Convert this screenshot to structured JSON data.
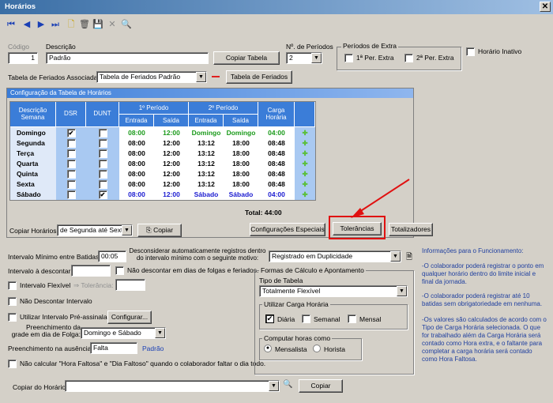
{
  "window": {
    "title": "Horários",
    "close": "✕"
  },
  "toolbar": {
    "first": "⏮",
    "prev": "◀",
    "next": "▶",
    "last": "⏭",
    "new": "🗋",
    "delete": "🗑",
    "save": "💾",
    "cancel": "✕",
    "search": "🔍"
  },
  "form": {
    "codigo_label": "Código",
    "codigo_value": "1",
    "descricao_label": "Descrição",
    "descricao_value": "Padrão",
    "copiar_tabela": "Copiar Tabela",
    "num_periodos_label": "Nº. de Períodos",
    "num_periodos_value": "2",
    "periodos_extra_label": "Períodos de Extra",
    "per_extra1": "1ª Per. Extra",
    "per_extra2": "2ª Per. Extra",
    "horario_inativo": "Horário Inativo",
    "feriados_label": "Tabela de Feriados Associada:",
    "feriados_value": "Tabela de Feriados Padrão",
    "feriados_btn": "Tabela de Feriados"
  },
  "grid": {
    "title": "Configuração da Tabela de Horários",
    "headers": {
      "descricao": "Descrição Semana",
      "dsr": "DSR",
      "dunt": "DUNT",
      "p1": "1º Período",
      "p2": "2º Período",
      "entrada": "Entrada",
      "saida": "Saída",
      "carga": "Carga Horária"
    },
    "rows": [
      {
        "dia": "Domingo",
        "dsr": "✔",
        "dunt": "",
        "e1": "08:00",
        "s1": "12:00",
        "e2": "Domingo",
        "s2": "Domingo",
        "carga": "04:00",
        "color": "#1a9a1a"
      },
      {
        "dia": "Segunda",
        "dsr": "",
        "dunt": "",
        "e1": "08:00",
        "s1": "12:00",
        "e2": "13:12",
        "s2": "18:00",
        "carga": "08:48",
        "color": "#000"
      },
      {
        "dia": "Terça",
        "dsr": "",
        "dunt": "",
        "e1": "08:00",
        "s1": "12:00",
        "e2": "13:12",
        "s2": "18:00",
        "carga": "08:48",
        "color": "#000"
      },
      {
        "dia": "Quarta",
        "dsr": "",
        "dunt": "",
        "e1": "08:00",
        "s1": "12:00",
        "e2": "13:12",
        "s2": "18:00",
        "carga": "08:48",
        "color": "#000"
      },
      {
        "dia": "Quinta",
        "dsr": "",
        "dunt": "",
        "e1": "08:00",
        "s1": "12:00",
        "e2": "13:12",
        "s2": "18:00",
        "carga": "08:48",
        "color": "#000"
      },
      {
        "dia": "Sexta",
        "dsr": "",
        "dunt": "",
        "e1": "08:00",
        "s1": "12:00",
        "e2": "13:12",
        "s2": "18:00",
        "carga": "08:48",
        "color": "#000"
      },
      {
        "dia": "Sábado",
        "dsr": "",
        "dunt": "✔",
        "e1": "08:00",
        "s1": "12:00",
        "e2": "Sábado",
        "s2": "Sábado",
        "carga": "04:00",
        "color": "#1a1ad0"
      }
    ],
    "total": "Total:  44:00",
    "copiar_horarios_label": "Copiar Horários:",
    "copiar_horarios_value": "de Segunda até Sexta",
    "copiar_btn": "Copiar",
    "config_especiais": "Configurações Especiais",
    "tolerancias": "Tolerâncias",
    "totalizadores": "Totalizadores"
  },
  "opts": {
    "intervalo_min_label": "Intervalo Mínimo entre Batidas:",
    "intervalo_min_value": "00:05",
    "desconsiderar_label": "Desconsiderar automaticamente registros dentro do intervalo mínimo com o seguinte motivo:",
    "motivo_value": "Registrado em Duplicidade",
    "intervalo_desc_label": "Intervalo à descontar:",
    "nao_descontar_folgas": "Não descontar em dias de folgas e feriados.",
    "intervalo_flexivel": "Intervalo Flexível",
    "tolerancia": "⇒ Tolerância:",
    "nao_descontar_intervalo": "Não Descontar Intervalo",
    "pre_assinalado": "Utilizar Intervalo Pré-assinalado",
    "configurar": "Configurar...",
    "preench_grade_label": "Preenchimento da grade em dia de Folga:",
    "preench_grade_value": "Domingo e Sábado",
    "preench_ausencia_label": "Preenchimento na ausência:",
    "preench_ausencia_value": "Falta",
    "padrao": "Padrão",
    "nao_calcular": "Não calcular \"Hora Faltosa\" e \"Dia Faltoso\" quando o colaborador faltar o dia todo.",
    "copiar_horario_label": "Copiar do Horário:",
    "copiar_btn": "Copiar"
  },
  "calc": {
    "group": "Formas de Cálculo e Apontamento",
    "tipo_label": "Tipo de Tabela",
    "tipo_value": "Totalmente Flexível",
    "carga_group": "Utilizar Carga Horária",
    "diaria": "Diária",
    "semanal": "Semanal",
    "mensal": "Mensal",
    "computar_group": "Computar horas como",
    "mensalista": "Mensalista",
    "horista": "Horista"
  },
  "info": {
    "title": "Informações para o Funcionamento:",
    "p1": "-O colaborador poderá registrar o ponto em qualquer horário dentro do limite inicial e final da jornada.",
    "p2": "-O colaborador poderá registrar até 10 batidas sem obrigatoriedade em nenhuma.",
    "p3": "-Os valores são calculados de acordo com o Tipo de Carga Horária selecionada. O que for trabalhado além da Carga Horária será contado como Hora extra, e o faltante para completar a carga horária será contado como Hora Faltosa."
  }
}
